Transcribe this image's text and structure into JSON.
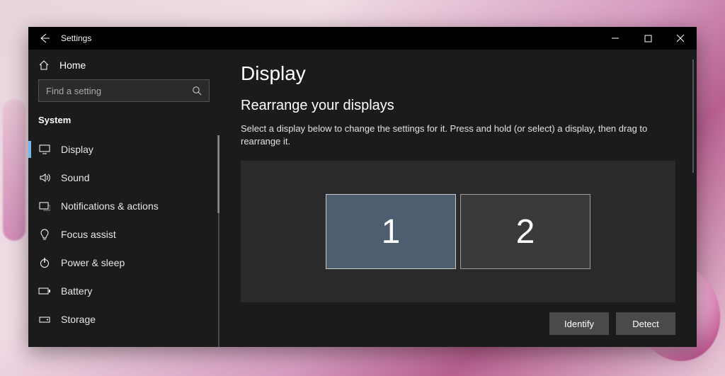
{
  "window": {
    "title": "Settings"
  },
  "sidebar": {
    "home_label": "Home",
    "search_placeholder": "Find a setting",
    "group_label": "System",
    "items": [
      {
        "label": "Display"
      },
      {
        "label": "Sound"
      },
      {
        "label": "Notifications & actions"
      },
      {
        "label": "Focus assist"
      },
      {
        "label": "Power & sleep"
      },
      {
        "label": "Battery"
      },
      {
        "label": "Storage"
      }
    ]
  },
  "page": {
    "title": "Display",
    "section_title": "Rearrange your displays",
    "description": "Select a display below to change the settings for it. Press and hold (or select) a display, then drag to rearrange it.",
    "monitors": [
      {
        "id": "1",
        "selected": true
      },
      {
        "id": "2",
        "selected": false
      }
    ],
    "identify_label": "Identify",
    "detect_label": "Detect"
  }
}
